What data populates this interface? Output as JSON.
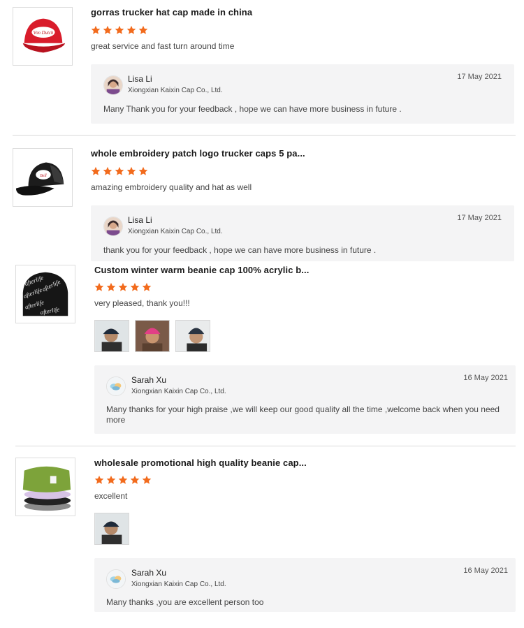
{
  "reviews": [
    {
      "product_title": "gorras trucker hat cap made in china",
      "rating": 5,
      "comment": "great service and fast turn around time",
      "reply": {
        "name": "Lisa Li",
        "company": "Xiongxian Kaixin Cap Co., Ltd.",
        "date": "17 May 2021",
        "text": "Many Thank you for your feedback , hope we can have more business in future ."
      }
    },
    {
      "product_title": "whole embroidery patch logo trucker caps 5 pa...",
      "rating": 5,
      "comment": "amazing embroidery quality and hat as well",
      "reply": {
        "name": "Lisa Li",
        "company": "Xiongxian Kaixin Cap Co., Ltd.",
        "date": "17 May 2021",
        "text": "thank you for your feedback , hope we can have more business in future ."
      }
    },
    {
      "product_title": "Custom winter warm beanie cap 100% acrylic b...",
      "rating": 5,
      "comment": "very pleased, thank you!!!",
      "photos": [
        "photo-1",
        "photo-2",
        "photo-3"
      ],
      "reply": {
        "name": "Sarah Xu",
        "company": "Xiongxian Kaixin Cap Co., Ltd.",
        "date": "16 May 2021",
        "text": "Many thanks for your high praise ,we will keep our good quality all the time ,welcome back when you need more"
      }
    },
    {
      "product_title": "wholesale promotional high quality beanie cap...",
      "rating": 5,
      "comment": "excellent",
      "photos": [
        "photo-1"
      ],
      "reply": {
        "name": "Sarah Xu",
        "company": "Xiongxian Kaixin Cap Co., Ltd.",
        "date": "16 May 2021",
        "text": "Many thanks ,you are excellent person too"
      }
    }
  ],
  "colors": {
    "star": "#f26b1d",
    "reply_bg": "#f4f4f5",
    "divider": "#d9d9d9"
  },
  "icons": {
    "rating": "star-icon",
    "product_images": [
      "red-trucker-cap-icon",
      "black-trucker-cap-icon",
      "black-beanie-icon",
      "green-beanie-stack-icon"
    ],
    "avatars": [
      "lisa-li-avatar",
      "sarah-xu-avatar"
    ]
  }
}
